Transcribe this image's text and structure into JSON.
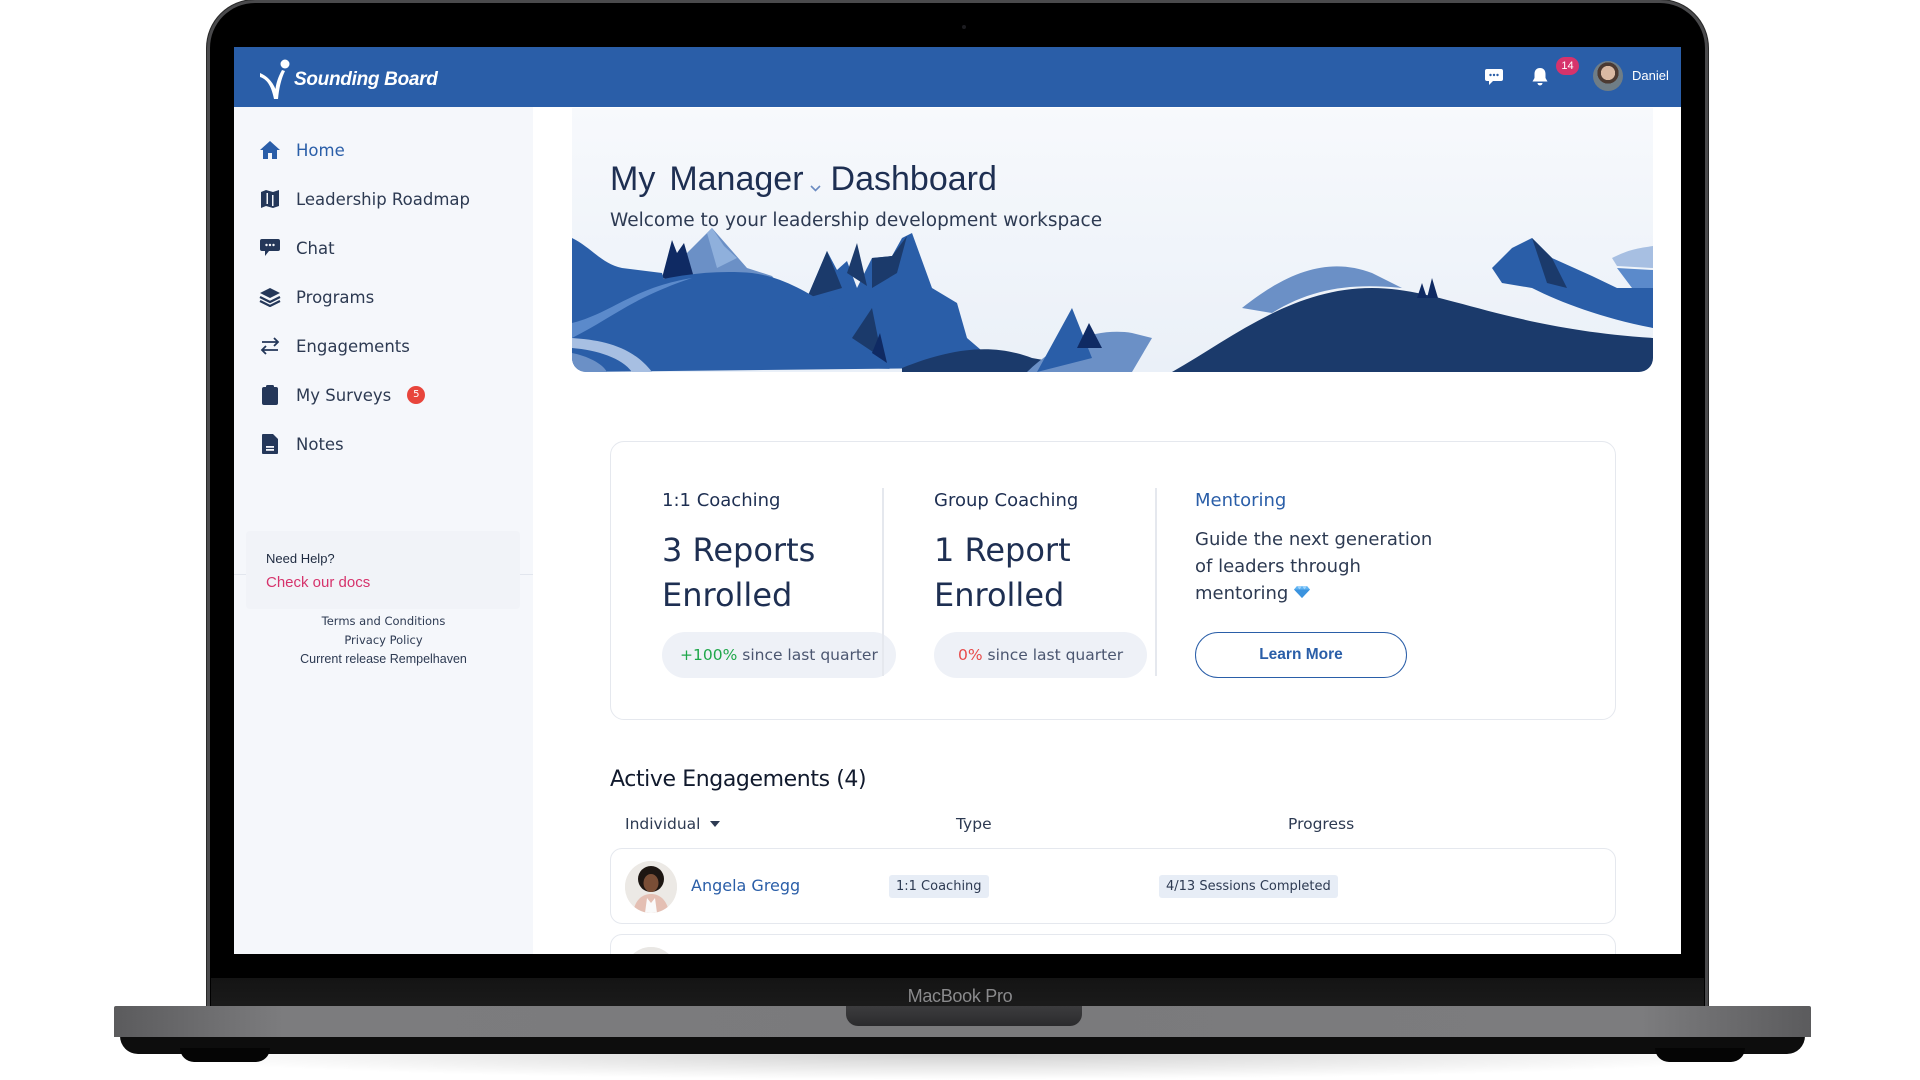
{
  "device": {
    "label": "MacBook Pro"
  },
  "header": {
    "brand": "Sounding Board",
    "notifications_count": "14",
    "user_name": "Daniel",
    "brand_color": "#2a5ea8",
    "badge_color": "#d6336c"
  },
  "sidebar": {
    "items": [
      {
        "label": "Home",
        "icon": "home-icon",
        "active": true
      },
      {
        "label": "Leadership Roadmap",
        "icon": "map-icon"
      },
      {
        "label": "Chat",
        "icon": "chat-icon"
      },
      {
        "label": "Programs",
        "icon": "layers-icon"
      },
      {
        "label": "Engagements",
        "icon": "swap-arrows-icon"
      },
      {
        "label": "My Surveys",
        "icon": "clipboard-icon",
        "badge": "5"
      },
      {
        "label": "Notes",
        "icon": "file-icon"
      }
    ],
    "help": {
      "title": "Need Help?",
      "link": "Check our docs"
    },
    "footer": {
      "terms": "Terms and Conditions",
      "privacy": "Privacy Policy",
      "release": "Current release Rempelhaven"
    }
  },
  "hero": {
    "title_prefix": "My",
    "role_selector": "Manager",
    "title_suffix": "Dashboard",
    "subtitle": "Welcome to your leadership development workspace"
  },
  "stats": [
    {
      "title": "1:1 Coaching",
      "line1": "3 Reports",
      "line2": "Enrolled",
      "change": "+100%",
      "change_suffix": " since last quarter",
      "change_color": "#1fa74a"
    },
    {
      "title": "Group Coaching",
      "line1": "1 Report",
      "line2": "Enrolled",
      "change": "0%",
      "change_suffix": " since last quarter",
      "change_color": "#e84a4a"
    }
  ],
  "mentoring": {
    "title": "Mentoring",
    "description": "Guide the next generation of leaders through mentoring",
    "button": "Learn More"
  },
  "engagements": {
    "title": "Active Engagements (4)",
    "columns": [
      "Individual",
      "Type",
      "Progress"
    ],
    "rows": [
      {
        "name": "Angela Gregg",
        "type": "1:1 Coaching",
        "progress": "4/13 Sessions Completed"
      },
      {
        "name": "",
        "type": "",
        "progress": ""
      }
    ]
  }
}
